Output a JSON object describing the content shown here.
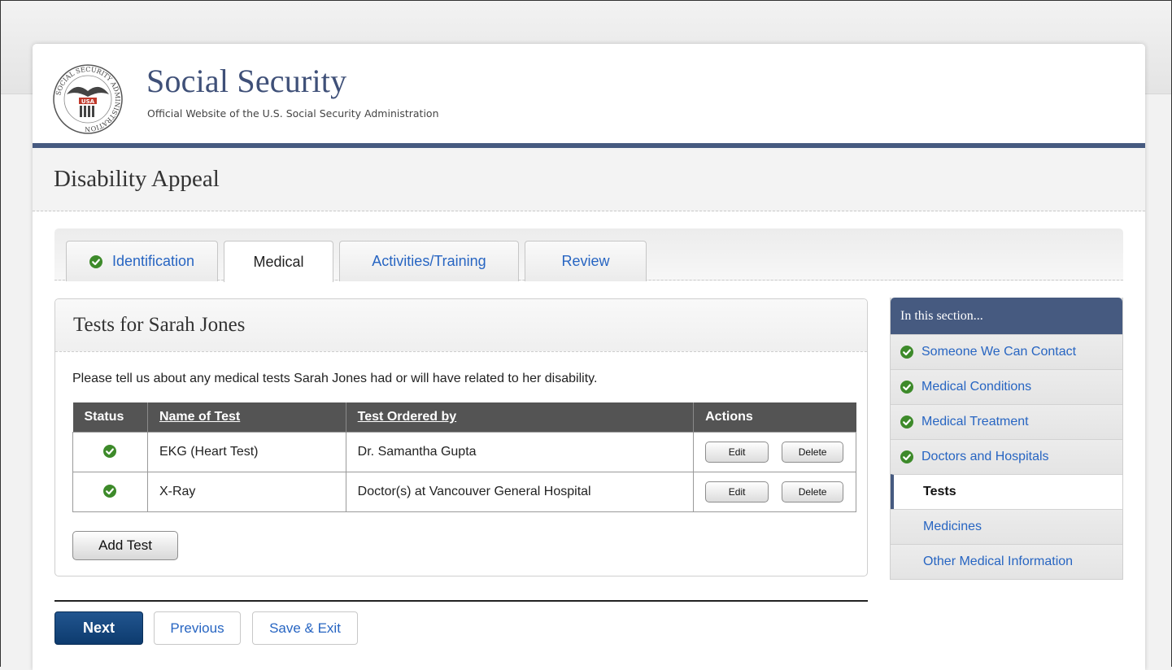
{
  "header": {
    "brand_title": "Social Security",
    "brand_subtitle": "Official Website of the U.S. Social Security Administration",
    "seal_text": "SOCIAL SECURITY ADMINISTRATION",
    "seal_usa": "USA"
  },
  "page_title": "Disability Appeal",
  "tabs": [
    {
      "label": "Identification",
      "completed": true
    },
    {
      "label": "Medical",
      "active": true
    },
    {
      "label": "Activities/Training"
    },
    {
      "label": "Review"
    }
  ],
  "panel": {
    "title": "Tests for Sarah Jones",
    "intro": "Please tell us about any medical tests Sarah Jones had or will have related to her disability.",
    "table": {
      "headers": [
        "Status",
        "Name of Test",
        "Test Ordered by",
        "Actions"
      ],
      "rows": [
        {
          "name": "EKG (Heart Test)",
          "ordered_by": "Dr. Samantha Gupta",
          "status": "complete"
        },
        {
          "name": "X-Ray",
          "ordered_by": "Doctor(s) at Vancouver General Hospital",
          "status": "complete"
        }
      ],
      "edit_label": "Edit",
      "delete_label": "Delete"
    },
    "add_label": "Add Test"
  },
  "nav": {
    "next": "Next",
    "previous": "Previous",
    "save_exit": "Save & Exit"
  },
  "sidebar": {
    "heading": "In this section...",
    "items": [
      {
        "label": "Someone We Can Contact",
        "completed": true
      },
      {
        "label": "Medical Conditions",
        "completed": true
      },
      {
        "label": "Medical Treatment",
        "completed": true
      },
      {
        "label": "Doctors and Hospitals",
        "completed": true
      },
      {
        "label": "Tests",
        "current": true
      },
      {
        "label": "Medicines"
      },
      {
        "label": "Other Medical Information"
      }
    ]
  },
  "colors": {
    "brand_blue": "#465a80",
    "link_blue": "#2765c2",
    "check_green": "#3d8a2a",
    "next_button": "#0d3b6e",
    "table_header": "#545454"
  }
}
